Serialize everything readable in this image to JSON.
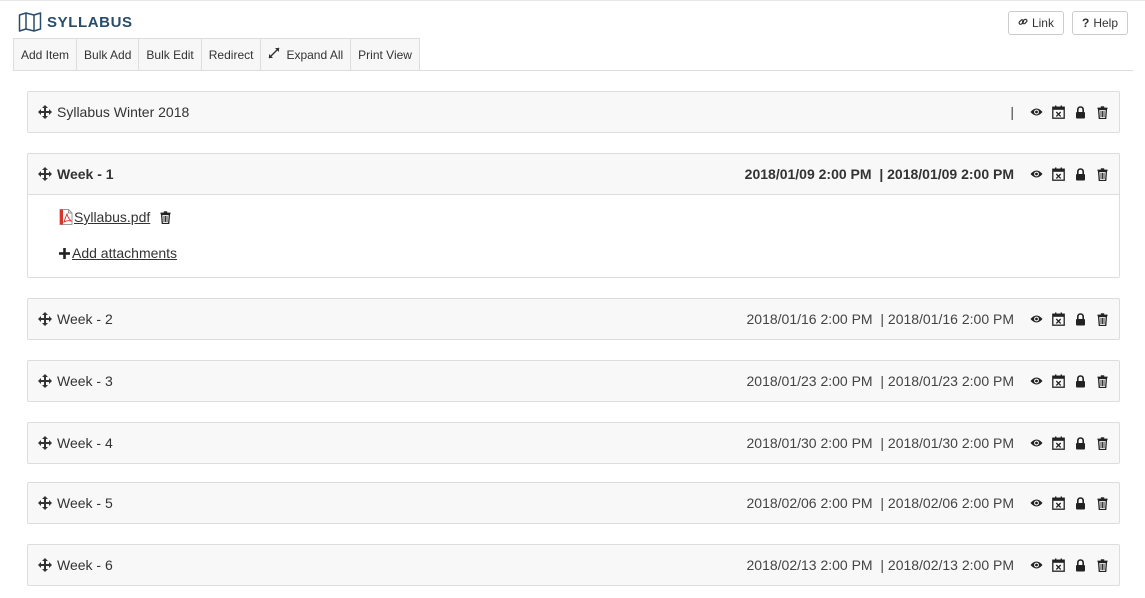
{
  "header": {
    "title": "SYLLABUS",
    "icon": "map-icon",
    "link_label": "Link",
    "help_label": "Help"
  },
  "toolbar": {
    "add_item": "Add Item",
    "bulk_add": "Bulk Add",
    "bulk_edit": "Bulk Edit",
    "redirect": "Redirect",
    "expand_all": "Expand All",
    "print_view": "Print View"
  },
  "items": [
    {
      "title": "Syllabus Winter 2018",
      "dates": "|",
      "bold": false
    },
    {
      "title": "Week - 1",
      "dates": "2018/01/09 2:00 PM  | 2018/01/09 2:00 PM",
      "bold": true,
      "attachments": [
        {
          "name": " Syllabus.pdf",
          "icon": "pdf-icon"
        }
      ],
      "add_attachments_label": " Add attachments"
    },
    {
      "title": "Week - 2",
      "dates": "2018/01/16 2:00 PM  | 2018/01/16 2:00 PM",
      "bold": false
    },
    {
      "title": "Week - 3",
      "dates": "2018/01/23 2:00 PM  | 2018/01/23 2:00 PM",
      "bold": false
    },
    {
      "title": "Week - 4",
      "dates": "2018/01/30 2:00 PM  | 2018/01/30 2:00 PM",
      "bold": false
    },
    {
      "title": "Week - 5",
      "dates": "2018/02/06 2:00 PM  | 2018/02/06 2:00 PM",
      "bold": false
    },
    {
      "title": "Week - 6",
      "dates": "2018/02/13 2:00 PM  | 2018/02/13 2:00 PM",
      "bold": false
    }
  ],
  "item_actions": [
    "eye-icon",
    "calendar-x-icon",
    "lock-icon",
    "trash-icon"
  ],
  "colors": {
    "title": "#2a4c6b",
    "panel_bg": "#f8f8f8",
    "border": "#dddddd"
  }
}
